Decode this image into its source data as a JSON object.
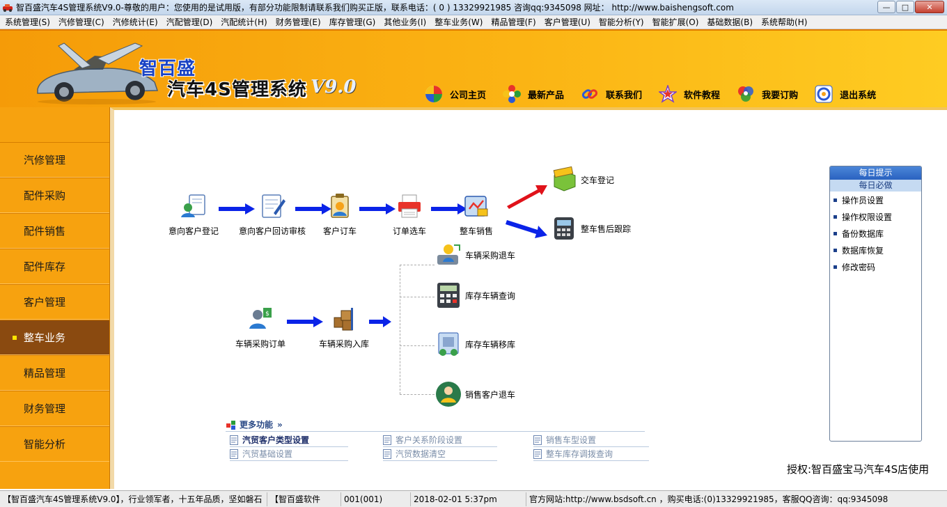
{
  "window": {
    "title": "智百盛汽车4S管理系统V9.0-尊敬的用户：您使用的是试用版，有部分功能限制请联系我们购买正版，联系电话：( 0 ) 13329921985  咨询qq:9345098   网址： http://www.baishengsoft.com",
    "minimize_glyph": "—",
    "maximize_glyph": "□",
    "close_glyph": "✕"
  },
  "menubar": [
    "系统管理(S)",
    "汽修管理(C)",
    "汽修统计(E)",
    "汽配管理(D)",
    "汽配统计(H)",
    "财务管理(E)",
    "库存管理(G)",
    "其他业务(I)",
    "整车业务(W)",
    "精品管理(F)",
    "客户管理(U)",
    "智能分析(Y)",
    "智能扩展(O)",
    "基础数据(B)",
    "系统帮助(H)"
  ],
  "header": {
    "brand": "智百盛",
    "product": "汽车4S管理系统",
    "version": "V9.0",
    "nav": [
      {
        "label": "公司主页",
        "icon": "pinwheel-icon"
      },
      {
        "label": "最新产品",
        "icon": "flower-icon"
      },
      {
        "label": "联系我们",
        "icon": "link-icon"
      },
      {
        "label": "软件教程",
        "icon": "star-icon"
      },
      {
        "label": "我要订购",
        "icon": "order-icon"
      },
      {
        "label": "退出系统",
        "icon": "exit-icon"
      }
    ]
  },
  "sidebar": {
    "items": [
      {
        "label": "汽修管理",
        "active": false
      },
      {
        "label": "配件采购",
        "active": false
      },
      {
        "label": "配件销售",
        "active": false
      },
      {
        "label": "配件库存",
        "active": false
      },
      {
        "label": "客户管理",
        "active": false
      },
      {
        "label": "整车业务",
        "active": true
      },
      {
        "label": "精品管理",
        "active": false
      },
      {
        "label": "财务管理",
        "active": false
      },
      {
        "label": "智能分析",
        "active": false
      }
    ]
  },
  "workflow": {
    "sales": [
      {
        "label": "意向客户登记"
      },
      {
        "label": "意向客户回访审核"
      },
      {
        "label": "客户订车"
      },
      {
        "label": "订单选车"
      },
      {
        "label": "整车销售"
      }
    ],
    "after_sale": [
      {
        "label": "交车登记"
      },
      {
        "label": "整车售后跟踪"
      }
    ],
    "purchase": [
      {
        "label": "车辆采购订单"
      },
      {
        "label": "车辆采购入库"
      }
    ],
    "purchase_branches": [
      {
        "label": "车辆采购退车"
      },
      {
        "label": "库存车辆查询"
      },
      {
        "label": "库存车辆移库"
      },
      {
        "label": "销售客户退车"
      }
    ]
  },
  "more_functions": {
    "title": "更多功能",
    "chevron": "»",
    "links": [
      {
        "label": "汽贸客户类型设置",
        "bold": true
      },
      {
        "label": "客户关系阶段设置",
        "bold": false
      },
      {
        "label": "销售车型设置",
        "bold": false
      },
      {
        "label": "汽贸基础设置",
        "bold": false
      },
      {
        "label": "汽贸数据清空",
        "bold": false
      },
      {
        "label": "整车库存调拨查询",
        "bold": false
      }
    ]
  },
  "tips": {
    "header": "每日提示",
    "subheader": "每日必做",
    "items": [
      "操作员设置",
      "操作权限设置",
      "备份数据库",
      "数据库恢复",
      "修改密码"
    ]
  },
  "license": "授权:智百盛宝马汽车4S店使用",
  "statusbar": {
    "slogan": "【智百盛汽车4S管理系统V9.0】，行业领军者，十五年品质，坚如磐石",
    "company": "【智百盛软件",
    "user": "001(001)",
    "datetime": "2018-02-01 5:37pm",
    "contact": "官方网站:http://www.bsdsoft.cn ，购买电话:(0)13329921985，客服QQ咨询：qq:9345098"
  },
  "colors": {
    "header_orange": "#f59b08",
    "sidebar_orange": "#f7a20f",
    "sidebar_active": "#8a4a10",
    "arrow_blue": "#0a23e8",
    "arrow_red": "#e0121a"
  }
}
